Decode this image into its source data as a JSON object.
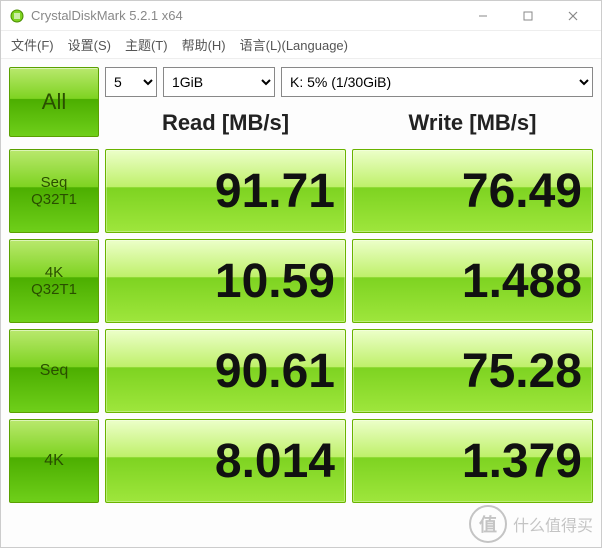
{
  "window": {
    "title": "CrystalDiskMark 5.2.1 x64"
  },
  "menu": {
    "file": "文件(F)",
    "settings": "设置(S)",
    "theme": "主题(T)",
    "help": "帮助(H)",
    "language": "语言(L)(Language)"
  },
  "controls": {
    "count": "5",
    "size": "1GiB",
    "drive": "K: 5% (1/30GiB)"
  },
  "buttons": {
    "all": "All",
    "seq_q32t1_l1": "Seq",
    "seq_q32t1_l2": "Q32T1",
    "k4_q32t1_l1": "4K",
    "k4_q32t1_l2": "Q32T1",
    "seq": "Seq",
    "k4": "4K"
  },
  "headers": {
    "read": "Read [MB/s]",
    "write": "Write [MB/s]"
  },
  "results": {
    "seq_q32t1": {
      "read": "91.71",
      "write": "76.49"
    },
    "k4_q32t1": {
      "read": "10.59",
      "write": "1.488"
    },
    "seq": {
      "read": "90.61",
      "write": "75.28"
    },
    "k4": {
      "read": "8.014",
      "write": "1.379"
    }
  },
  "watermark": {
    "badge": "值",
    "text": "什么值得买"
  },
  "chart_data": {
    "type": "table",
    "title": "CrystalDiskMark 5.2.1 x64 – K: 5% (1/30GiB), 5×1GiB",
    "columns": [
      "Test",
      "Read [MB/s]",
      "Write [MB/s]"
    ],
    "rows": [
      [
        "Seq Q32T1",
        91.71,
        76.49
      ],
      [
        "4K Q32T1",
        10.59,
        1.488
      ],
      [
        "Seq",
        90.61,
        75.28
      ],
      [
        "4K",
        8.014,
        1.379
      ]
    ]
  }
}
